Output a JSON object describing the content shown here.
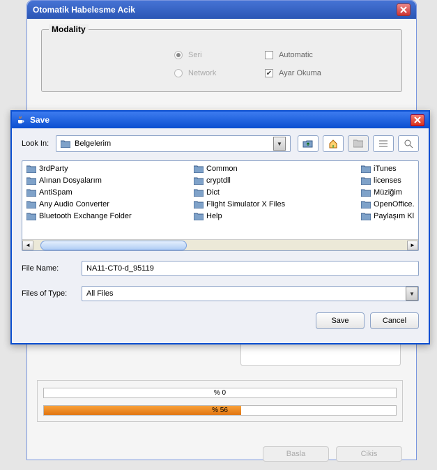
{
  "bg_window": {
    "title": "Otomatik Habelesme Acik",
    "modality": {
      "label": "Modality",
      "opt_seri": "Seri",
      "opt_network": "Network",
      "chk_automatic": "Automatic",
      "chk_ayar": "Ayar Okuma"
    },
    "progress": {
      "p1_label": "% 0",
      "p1_value": 0,
      "p2_label": "% 56",
      "p2_value": 56
    },
    "buttons": {
      "basla": "Basla",
      "cikis": "Cikis"
    }
  },
  "save_dialog": {
    "title": "Save",
    "look_in_label": "Look In:",
    "current_folder": "Belgelerim",
    "folders_col1": [
      "3rdParty",
      "Alınan Dosyalarım",
      "AntiSpam",
      "Any Audio Converter",
      "Bluetooth Exchange Folder"
    ],
    "folders_col2": [
      "Common",
      "cryptdll",
      "Dict",
      "Flight Simulator X Files",
      "Help"
    ],
    "folders_col3": [
      "iTunes",
      "licenses",
      "Müziğim",
      "OpenOffice.",
      "Paylaşım Kl"
    ],
    "file_name_label": "File Name:",
    "file_name_value": "NA11-CT0-d_95119",
    "file_type_label": "Files of Type:",
    "file_type_value": "All Files",
    "save_btn": "Save",
    "cancel_btn": "Cancel"
  }
}
